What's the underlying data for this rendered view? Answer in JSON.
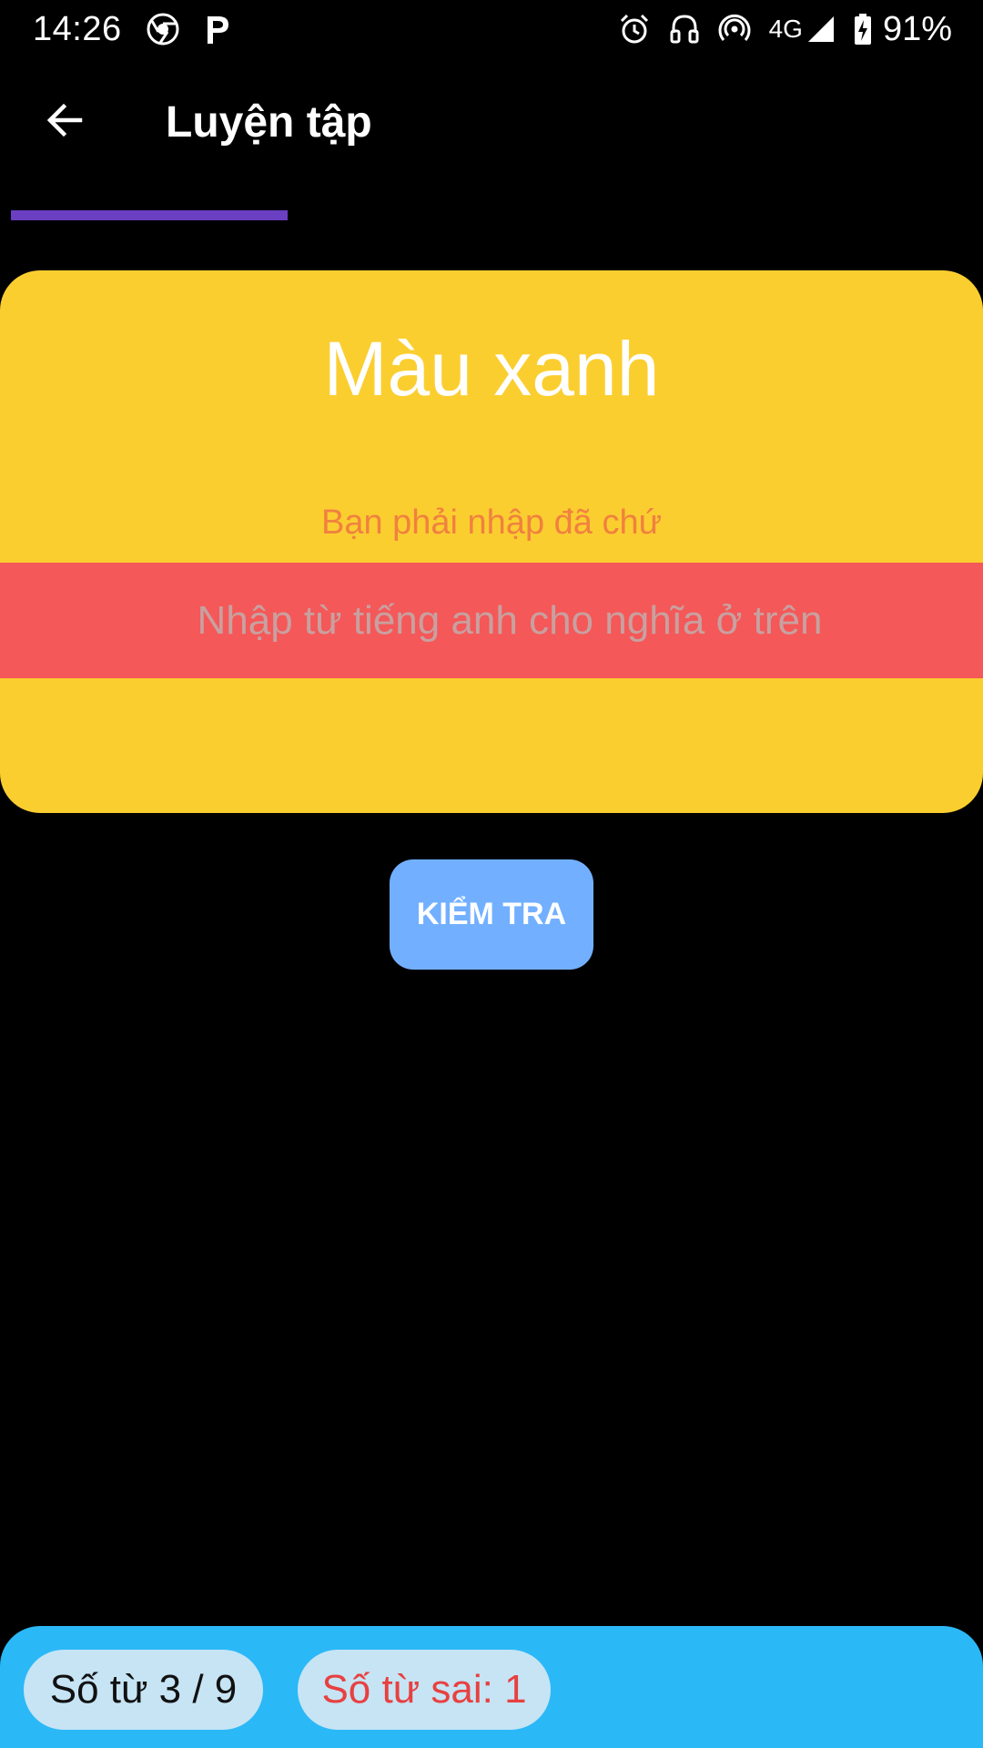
{
  "status_bar": {
    "time": "14:26",
    "network": "4G",
    "battery": "91%",
    "icons": [
      "chrome-icon",
      "p-app-icon",
      "alarm-icon",
      "headset-icon",
      "hotspot-icon",
      "signal-icon",
      "battery-charging-icon"
    ]
  },
  "app_bar": {
    "back_icon": "arrow-back-icon",
    "title": "Luyện tập"
  },
  "progress": {
    "current": 3,
    "total": 9,
    "fraction": 0.333,
    "color": "#6a3fc1"
  },
  "card": {
    "word": "Màu xanh",
    "error_message": "Bạn phải nhập đã chứ",
    "input_value": "",
    "input_placeholder": "Nhập từ tiếng anh cho nghĩa ở trên",
    "background_color": "#fbce30",
    "input_color": "#f45858"
  },
  "actions": {
    "check_label": "KIỂM TRA",
    "check_color": "#72b0ff"
  },
  "bottom_panel": {
    "word_count_label": "Số từ 3 / 9",
    "wrong_count_label": "Số từ sai: 1",
    "background_color": "#2bb8f7"
  }
}
